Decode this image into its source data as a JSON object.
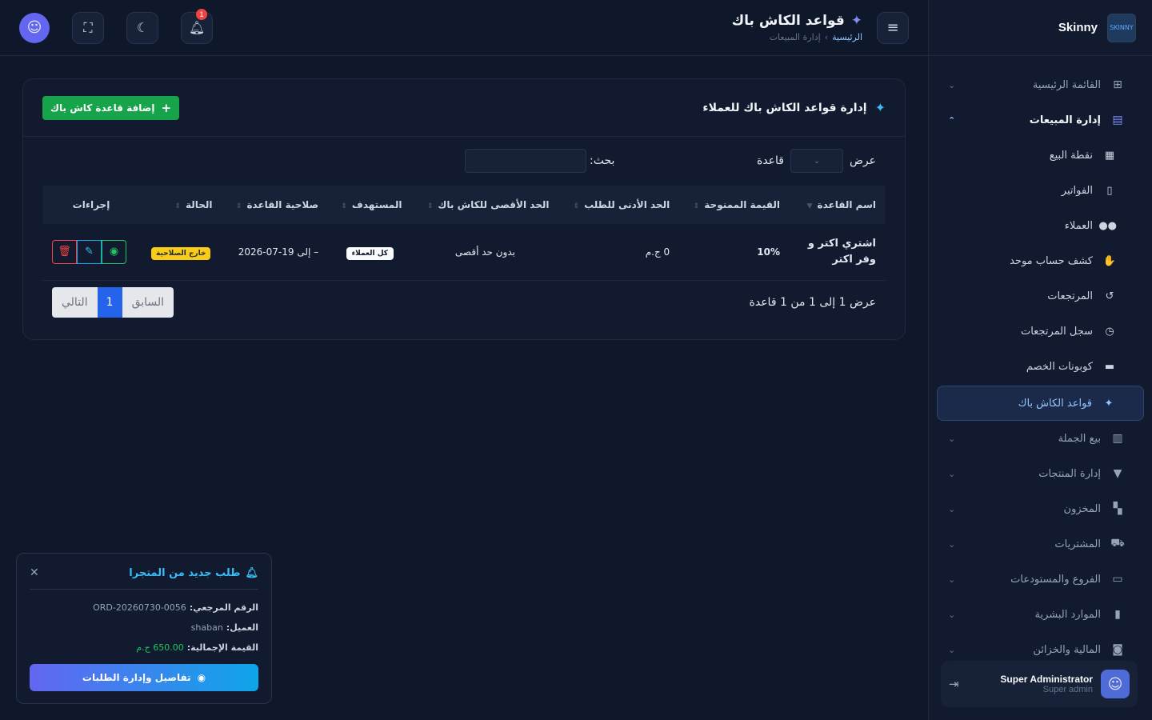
{
  "brand": {
    "name": "Skinny",
    "logo_text": "SKINNY"
  },
  "sidebar": {
    "items": [
      {
        "label": "القائمة الرئيسية",
        "icon": "grid-icon"
      },
      {
        "label": "إدارة المبيعات",
        "icon": "cash-register-icon",
        "open": true
      },
      {
        "label": "بيع الجملة",
        "icon": "warehouse-icon"
      },
      {
        "label": "إدارة المنتجات",
        "icon": "shirt-icon"
      },
      {
        "label": "المخزون",
        "icon": "boxes-icon"
      },
      {
        "label": "المشتريات",
        "icon": "cart-icon"
      },
      {
        "label": "الفروع والمستودعات",
        "icon": "store-icon"
      },
      {
        "label": "الموارد البشرية",
        "icon": "id-badge-icon"
      },
      {
        "label": "المالية والخزائن",
        "icon": "money-icon"
      }
    ],
    "sales_sub": [
      {
        "label": "نقطة البيع",
        "icon": "cash-register-icon"
      },
      {
        "label": "الفواتير",
        "icon": "invoice-icon"
      },
      {
        "label": "العملاء",
        "icon": "users-icon"
      },
      {
        "label": "كشف حساب موحد",
        "icon": "handshake-icon"
      },
      {
        "label": "المرتجعات",
        "icon": "undo-icon"
      },
      {
        "label": "سجل المرتجعات",
        "icon": "history-icon"
      },
      {
        "label": "كوبونات الخصم",
        "icon": "ticket-icon"
      },
      {
        "label": "قواعد الكاش باك",
        "icon": "hand-coin-icon",
        "active": true
      }
    ]
  },
  "user": {
    "name": "Super Administrator",
    "role": "Super admin"
  },
  "header": {
    "title": "قواعد الكاش باك",
    "breadcrumb_home": "الرئيسية",
    "breadcrumb_sep": "›",
    "breadcrumb_current": "إدارة المبيعات",
    "notification_count": "1"
  },
  "card": {
    "title": "إدارة قواعد الكاش باك للعملاء",
    "add_label": "إضافة قاعدة كاش باك",
    "show_label": "عرض",
    "unit_label": "قاعدة",
    "search_label": "بحث:",
    "search_value": ""
  },
  "table": {
    "headers": [
      "اسم القاعدة",
      "القيمة الممنوحة",
      "الحد الأدنى للطلب",
      "الحد الأقصى للكاش باك",
      "المستهدف",
      "صلاحية القاعدة",
      "الحالة",
      "إجراءات"
    ],
    "rows": [
      {
        "name": "اشتري اكتر و وفر اكتر",
        "value": "10%",
        "min_order": "0 ج.م",
        "max_cashback": "بدون حد أقصى",
        "target": "كل العملاء",
        "validity": "– إلى 19-07-2026",
        "status": "خارج الصلاحية"
      }
    ]
  },
  "footer": {
    "info": "عرض 1 إلى 1 من 1 قاعدة",
    "prev": "السابق",
    "page": "1",
    "next": "التالي"
  },
  "toast": {
    "title": "طلب جديد من المتجرا",
    "ref_label": "الرقم المرجعي:",
    "ref_value": "ORD-20260730-0056",
    "customer_label": "العميل:",
    "customer_value": "shaban",
    "total_label": "القيمة الإجمالية:",
    "total_value": "650.00 ج.م",
    "button": "تفاصيل وإدارة الطلبات"
  },
  "colors": {
    "accent": "#6366f1",
    "success": "#16a34a",
    "danger": "#ef4444",
    "warning": "#facc15",
    "info": "#38bdf8"
  }
}
